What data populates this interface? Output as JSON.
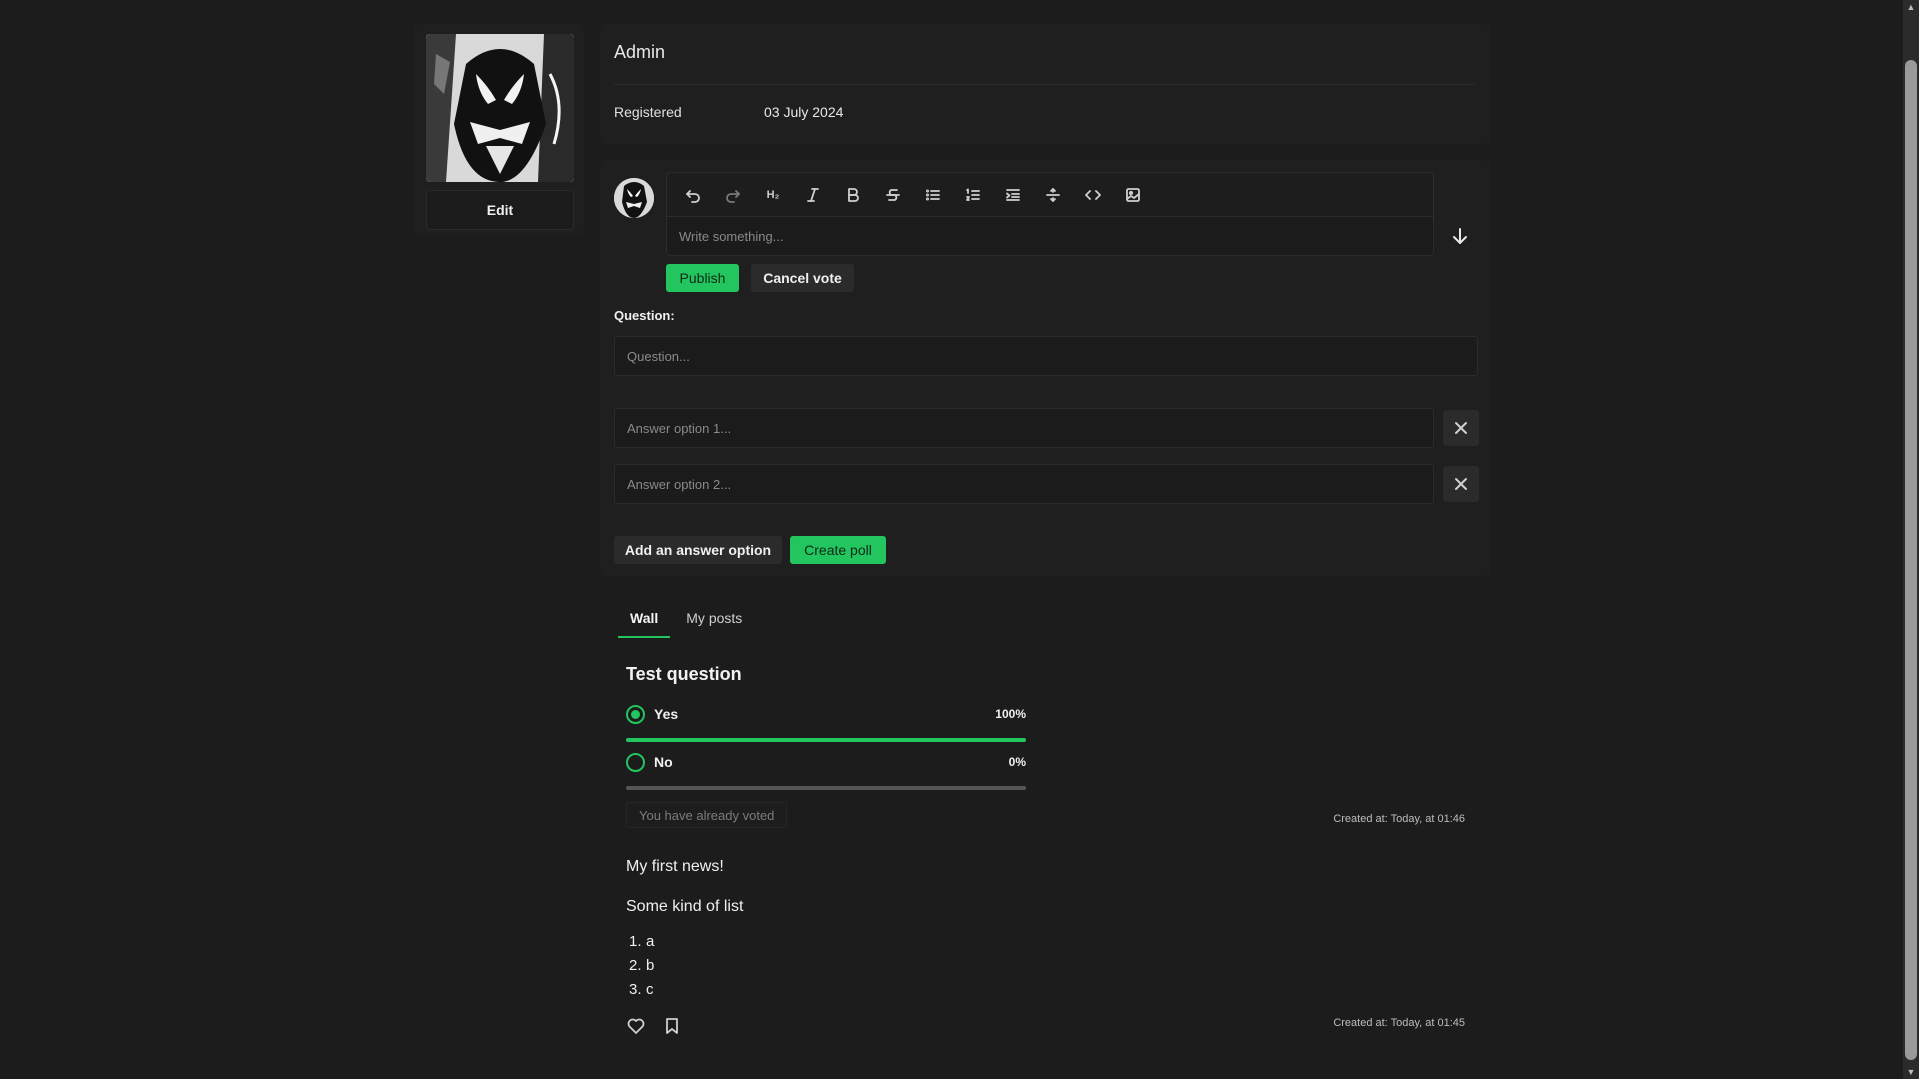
{
  "profile": {
    "username": "Admin",
    "edit_label": "Edit",
    "registered_label": "Registered",
    "registered_value": "03 July 2024"
  },
  "composer": {
    "toolbar": [
      {
        "name": "undo-icon",
        "label": "Undo"
      },
      {
        "name": "redo-icon",
        "label": "Redo"
      },
      {
        "name": "heading-icon",
        "label": "H2"
      },
      {
        "name": "italic-icon",
        "label": "Italic"
      },
      {
        "name": "bold-icon",
        "label": "Bold"
      },
      {
        "name": "strikethrough-icon",
        "label": "Strikethrough"
      },
      {
        "name": "bullet-list-icon",
        "label": "Bullet list"
      },
      {
        "name": "ordered-list-icon",
        "label": "Ordered list"
      },
      {
        "name": "indent-icon",
        "label": "Indent"
      },
      {
        "name": "horizontal-rule-icon",
        "label": "Horizontal rule"
      },
      {
        "name": "code-icon",
        "label": "Code"
      },
      {
        "name": "image-icon",
        "label": "Image"
      }
    ],
    "heading_label": "H₂",
    "placeholder": "Write something...",
    "publish_label": "Publish",
    "cancel_vote_label": "Cancel vote"
  },
  "poll_form": {
    "question_label": "Question:",
    "question_placeholder": "Question...",
    "answer1_placeholder": "Answer option 1...",
    "answer2_placeholder": "Answer option 2...",
    "add_answer_label": "Add an answer option",
    "create_poll_label": "Create poll"
  },
  "tabs": [
    {
      "label": "Wall",
      "active": true
    },
    {
      "label": "My posts",
      "active": false
    }
  ],
  "feed": {
    "poll": {
      "title": "Test question",
      "options": [
        {
          "label": "Yes",
          "percent_label": "100%",
          "percent": 100,
          "selected": true
        },
        {
          "label": "No",
          "percent_label": "0%",
          "percent": 0,
          "selected": false
        }
      ],
      "voted_label": "You have already voted",
      "created_at": "Created at: Today, at 01:46"
    },
    "news": {
      "title": "My first news!",
      "subtitle": "Some kind of list",
      "list": [
        {
          "num": "1.",
          "text": "a"
        },
        {
          "num": "2.",
          "text": "b"
        },
        {
          "num": "3.",
          "text": "c"
        }
      ],
      "created_at": "Created at: Today, at 01:45"
    }
  },
  "colors": {
    "background": "#1c1c1c",
    "card": "#1f1f1f",
    "accent": "#22c55e"
  }
}
